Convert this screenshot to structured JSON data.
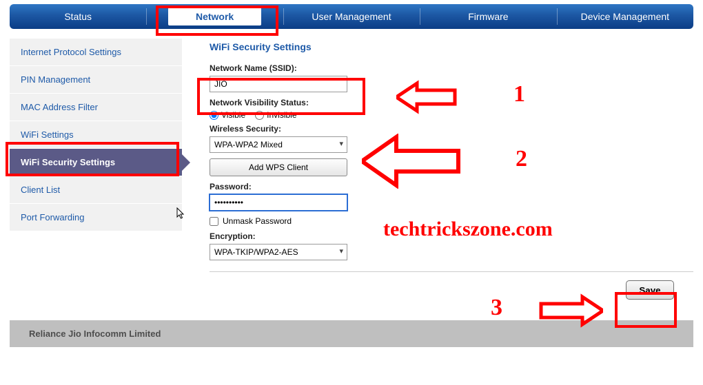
{
  "nav": {
    "items": [
      "Status",
      "Network",
      "User Management",
      "Firmware",
      "Device Management"
    ],
    "active": "Network"
  },
  "sidebar": {
    "items": [
      "Internet Protocol Settings",
      "PIN Management",
      "MAC Address Filter",
      "WiFi Settings",
      "WiFi Security Settings",
      "Client List",
      "Port Forwarding"
    ],
    "selected": "WiFi Security Settings"
  },
  "page": {
    "title": "WiFi Security Settings",
    "ssid_label": "Network Name (SSID):",
    "ssid_value": "JIO",
    "visibility_label": "Network Visibility Status:",
    "visibility_options": {
      "a": "Visible",
      "b": "Invisible"
    },
    "visibility_selected": "Visible",
    "security_label": "Wireless Security:",
    "security_value": "WPA-WPA2 Mixed",
    "wps_button": "Add WPS Client",
    "password_label": "Password:",
    "password_value": "••••••••••",
    "unmask_label": "Unmask Password",
    "unmask_checked": false,
    "encryption_label": "Encryption:",
    "encryption_value": "WPA-TKIP/WPA2-AES",
    "save_button": "Save"
  },
  "footer": "Reliance Jio Infocomm Limited",
  "annotations": {
    "n1": "1",
    "n2": "2",
    "n3": "3",
    "watermark": "techtrickszone.com"
  }
}
